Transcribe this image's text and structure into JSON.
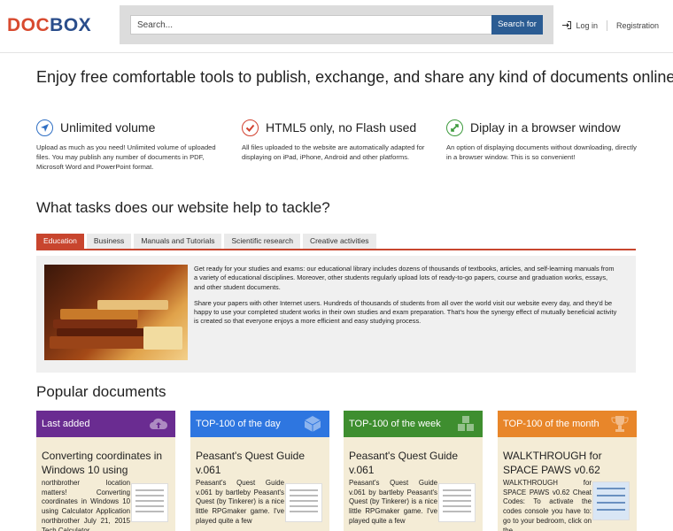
{
  "header": {
    "logo_part1": "DOC",
    "logo_part2": "BOX",
    "search_placeholder": "Search...",
    "search_button": "Search for",
    "login": "Log in",
    "registration": "Registration"
  },
  "hero": "Enjoy free comfortable tools to publish, exchange, and share any kind of documents online!",
  "features": [
    {
      "title": "Unlimited volume",
      "desc": "Upload as much as you need! Unlimited volume of uploaded files. You may publish any number of documents in PDF, Microsoft Word and PowerPoint format."
    },
    {
      "title": "HTML5 only, no Flash used",
      "desc": "All files uploaded to the website are automatically adapted for displaying on iPad, iPhone, Android and other platforms."
    },
    {
      "title": "Diplay in a browser window",
      "desc": "An option of displaying documents without downloading, directly in a browser window. This is so convenient!"
    }
  ],
  "tasks_heading": "What tasks does our website help to tackle?",
  "tabs": [
    "Education",
    "Business",
    "Manuals and Tutorials",
    "Scientific research",
    "Creative activities"
  ],
  "tab_content": {
    "p1": "Get ready for your studies and exams: our educational library includes dozens of thousands of textbooks, articles, and self-learning manuals from a variety of educational disciplines. Moreover, other students regularly upload lots of ready-to-go papers, course and graduation works, essays, and other student documents.",
    "p2": "Share your papers with other Internet users. Hundreds of thousands of students from all over the world visit our website every day, and they'd be happy to use your completed student works in their own studies and exam preparation. That's how the synergy effect of mutually beneficial activity is created so that everyone enjoys a more efficient and easy studying process."
  },
  "popular_heading": "Popular documents",
  "columns": [
    {
      "header": "Last added",
      "color": "#6a2c91",
      "title": "Converting coordinates in Windows 10 using",
      "snippet": "northbrother location matters! Converting coordinates in Windows 10 using Calculator Application northbrother July 21, 2015 Tech Calculator"
    },
    {
      "header": "TOP-100 of the day",
      "color": "#2e76e0",
      "title": "Peasant's Quest Guide v.061",
      "snippet": "Peasant's Quest Guide v.061 by bartleby Peasant's Quest (by Tinkerer) is a nice little RPGmaker game. I've played quite a few"
    },
    {
      "header": "TOP-100 of the week",
      "color": "#3e8e2f",
      "title": "Peasant's Quest Guide v.061",
      "snippet": "Peasant's Quest Guide v.061 by bartleby Peasant's Quest (by Tinkerer) is a nice little RPGmaker game. I've played quite a few"
    },
    {
      "header": "TOP-100 of the month",
      "color": "#e8862a",
      "title": "WALKTHROUGH for SPACE PAWS v0.62",
      "snippet": "WALKTHROUGH for SPACE PAWS v0.62 Cheat Codes: To activate the codes console you have to: go to your bedroom, click on the"
    }
  ]
}
